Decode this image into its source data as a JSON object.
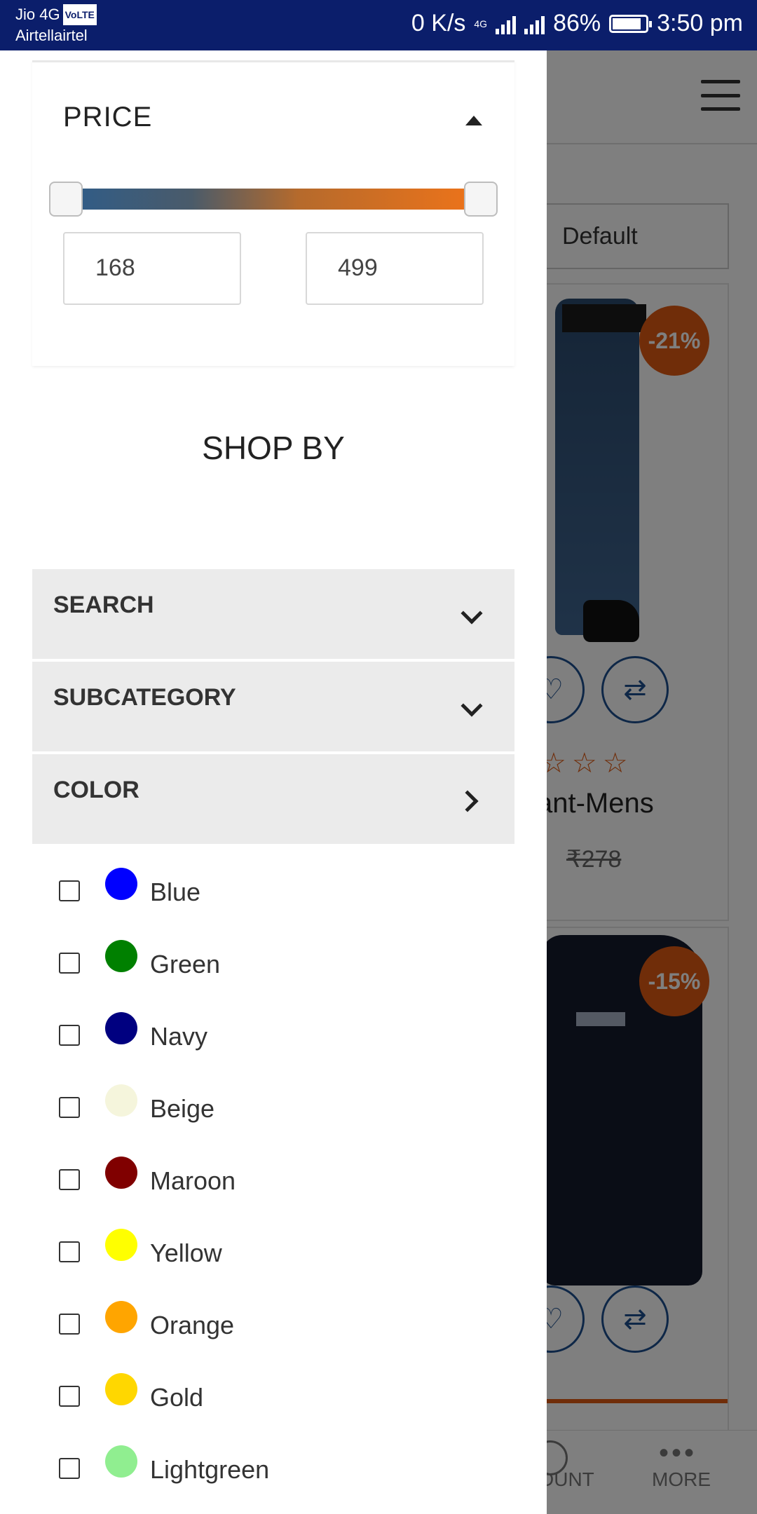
{
  "status_bar": {
    "carrier1": "Jio 4G",
    "volte": "VoLTE",
    "carrier2": "Airtellairtel",
    "speed": "0 K/s",
    "network": "4G",
    "battery": "86%",
    "time": "3:50 pm"
  },
  "price_filter": {
    "title": "PRICE",
    "min_value": "168",
    "max_value": "499"
  },
  "shop_by": {
    "title": "SHOP BY"
  },
  "accordion": [
    {
      "label": "SEARCH"
    },
    {
      "label": "SUBCATEGORY"
    },
    {
      "label": "COLOR"
    }
  ],
  "colors": [
    {
      "label": "Blue",
      "hex": "#0000ff"
    },
    {
      "label": "Green",
      "hex": "#008000"
    },
    {
      "label": "Navy",
      "hex": "#000080"
    },
    {
      "label": "Beige",
      "hex": "#f5f5dc"
    },
    {
      "label": "Maroon",
      "hex": "#800000"
    },
    {
      "label": "Yellow",
      "hex": "#ffff00"
    },
    {
      "label": "Orange",
      "hex": "#ffa500"
    },
    {
      "label": "Gold",
      "hex": "#ffd700"
    },
    {
      "label": "Lightgreen",
      "hex": "#90ee90"
    }
  ],
  "background_page": {
    "sort_value": "Default",
    "product1": {
      "discount": "-21%",
      "name_partial": "ant-Mens",
      "old_price": "₹278"
    },
    "product2": {
      "discount": "-15%"
    },
    "nav": {
      "account_partial": "DUNT",
      "more": "MORE"
    }
  }
}
